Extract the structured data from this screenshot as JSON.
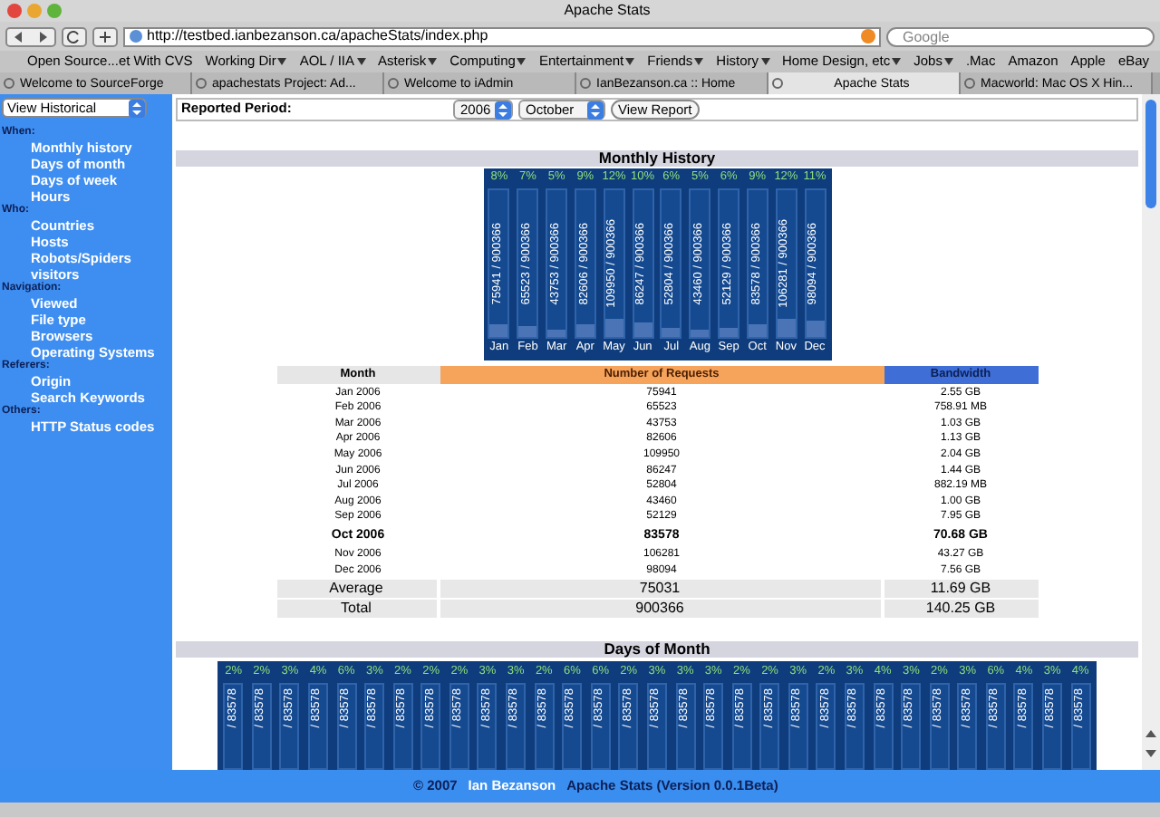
{
  "window": {
    "title": "Apache Stats"
  },
  "toolbar": {
    "url": "http://testbed.ianbezanson.ca/apacheStats/index.php",
    "search_placeholder": "Google"
  },
  "bookmarks": [
    {
      "label": "Open Source...et With CVS",
      "menu": false
    },
    {
      "label": "Working Dir",
      "menu": true
    },
    {
      "label": "AOL / IIA",
      "menu": true
    },
    {
      "label": "Asterisk",
      "menu": true
    },
    {
      "label": "Computing",
      "menu": true
    },
    {
      "label": "Entertainment",
      "menu": true
    },
    {
      "label": "Friends",
      "menu": true
    },
    {
      "label": "History",
      "menu": true
    },
    {
      "label": "Home Design, etc",
      "menu": true
    },
    {
      "label": "Jobs",
      "menu": true
    },
    {
      "label": ".Mac",
      "menu": false
    },
    {
      "label": "Amazon",
      "menu": false
    },
    {
      "label": "Apple",
      "menu": false
    },
    {
      "label": "eBay",
      "menu": false
    }
  ],
  "tabs": [
    {
      "label": "Welcome to SourceForge",
      "selected": false
    },
    {
      "label": "apachestats Project: Ad...",
      "selected": false
    },
    {
      "label": "Welcome to iAdmin",
      "selected": false
    },
    {
      "label": "IanBezanson.ca :: Home",
      "selected": false
    },
    {
      "label": "Apache Stats",
      "selected": true
    },
    {
      "label": "Macworld: Mac OS X Hin...",
      "selected": false
    }
  ],
  "sidebar": {
    "view_select": "View Historical",
    "groups": [
      {
        "heading": "When:",
        "items": [
          "Monthly history",
          "Days of month",
          "Days of week",
          "Hours"
        ]
      },
      {
        "heading": "Who:",
        "items": [
          "Countries",
          "Hosts",
          "Robots/Spiders",
          "visitors"
        ]
      },
      {
        "heading": "Navigation:",
        "items": [
          "Viewed",
          "File type",
          "Browsers",
          "Operating Systems"
        ]
      },
      {
        "heading": "Referers:",
        "items": [
          "Origin",
          "Search Keywords"
        ]
      },
      {
        "heading": "Others:",
        "items": [
          "HTTP Status codes"
        ]
      }
    ]
  },
  "report_period": {
    "label": "Reported Period:",
    "year": "2006",
    "month": "October",
    "button": "View Report"
  },
  "monthly_history": {
    "title": "Monthly History",
    "bars": [
      {
        "percent": "8%",
        "count": "75941 / 900366",
        "month": "Jan",
        "level": 0.08
      },
      {
        "percent": "7%",
        "count": "65523 / 900366",
        "month": "Feb",
        "level": 0.07
      },
      {
        "percent": "5%",
        "count": "43753 / 900366",
        "month": "Mar",
        "level": 0.05
      },
      {
        "percent": "9%",
        "count": "82606 / 900366",
        "month": "Apr",
        "level": 0.09
      },
      {
        "percent": "12%",
        "count": "109950 / 900366",
        "month": "May",
        "level": 0.12
      },
      {
        "percent": "10%",
        "count": "86247 / 900366",
        "month": "Jun",
        "level": 0.1
      },
      {
        "percent": "6%",
        "count": "52804 / 900366",
        "month": "Jul",
        "level": 0.06
      },
      {
        "percent": "5%",
        "count": "43460 / 900366",
        "month": "Aug",
        "level": 0.05
      },
      {
        "percent": "6%",
        "count": "52129 / 900366",
        "month": "Sep",
        "level": 0.06
      },
      {
        "percent": "9%",
        "count": "83578 / 900366",
        "month": "Oct",
        "level": 0.09
      },
      {
        "percent": "12%",
        "count": "106281 / 900366",
        "month": "Nov",
        "level": 0.12
      },
      {
        "percent": "11%",
        "count": "98094 / 900366",
        "month": "Dec",
        "level": 0.11
      }
    ]
  },
  "table": {
    "columns": [
      "Month",
      "Number of Requests",
      "Bandwidth"
    ],
    "rows": [
      {
        "cells": [
          "Jan 2006",
          "75941",
          "2.55 GB"
        ],
        "selected": false
      },
      {
        "cells": [
          "Feb 2006",
          "65523",
          "758.91 MB"
        ],
        "selected": false
      },
      {
        "cells": [
          "Mar 2006",
          "43753",
          "1.03 GB"
        ],
        "selected": false
      },
      {
        "cells": [
          "Apr 2006",
          "82606",
          "1.13 GB"
        ],
        "selected": false
      },
      {
        "cells": [
          "May 2006",
          "109950",
          "2.04 GB"
        ],
        "selected": false
      },
      {
        "cells": [
          "Jun 2006",
          "86247",
          "1.44 GB"
        ],
        "selected": false
      },
      {
        "cells": [
          "Jul 2006",
          "52804",
          "882.19 MB"
        ],
        "selected": false
      },
      {
        "cells": [
          "Aug 2006",
          "43460",
          "1.00 GB"
        ],
        "selected": false
      },
      {
        "cells": [
          "Sep 2006",
          "52129",
          "7.95 GB"
        ],
        "selected": false
      },
      {
        "cells": [
          "Oct 2006",
          "83578",
          "70.68 GB"
        ],
        "selected": true
      },
      {
        "cells": [
          "Nov 2006",
          "106281",
          "43.27 GB"
        ],
        "selected": false
      },
      {
        "cells": [
          "Dec 2006",
          "98094",
          "7.56 GB"
        ],
        "selected": false
      }
    ],
    "summary": [
      [
        "Average",
        "75031",
        "11.69 GB"
      ],
      [
        "Total",
        "900366",
        "140.25 GB"
      ]
    ]
  },
  "days_of_month": {
    "title": "Days of Month",
    "bars": [
      {
        "percent": "2%",
        "count": "/ 83578"
      },
      {
        "percent": "2%",
        "count": "/ 83578"
      },
      {
        "percent": "3%",
        "count": "/ 83578"
      },
      {
        "percent": "4%",
        "count": "/ 83578"
      },
      {
        "percent": "6%",
        "count": "/ 83578"
      },
      {
        "percent": "3%",
        "count": "/ 83578"
      },
      {
        "percent": "2%",
        "count": "/ 83578"
      },
      {
        "percent": "2%",
        "count": "/ 83578"
      },
      {
        "percent": "2%",
        "count": "/ 83578"
      },
      {
        "percent": "3%",
        "count": "/ 83578"
      },
      {
        "percent": "3%",
        "count": "/ 83578"
      },
      {
        "percent": "2%",
        "count": "/ 83578"
      },
      {
        "percent": "6%",
        "count": "/ 83578"
      },
      {
        "percent": "6%",
        "count": "/ 83578"
      },
      {
        "percent": "2%",
        "count": "/ 83578"
      },
      {
        "percent": "3%",
        "count": "/ 83578"
      },
      {
        "percent": "3%",
        "count": "/ 83578"
      },
      {
        "percent": "3%",
        "count": "/ 83578"
      },
      {
        "percent": "2%",
        "count": "/ 83578"
      },
      {
        "percent": "2%",
        "count": "/ 83578"
      },
      {
        "percent": "3%",
        "count": "/ 83578"
      },
      {
        "percent": "2%",
        "count": "/ 83578"
      },
      {
        "percent": "3%",
        "count": "/ 83578"
      },
      {
        "percent": "4%",
        "count": "/ 83578"
      },
      {
        "percent": "3%",
        "count": "/ 83578"
      },
      {
        "percent": "2%",
        "count": "/ 83578"
      },
      {
        "percent": "3%",
        "count": "/ 83578"
      },
      {
        "percent": "6%",
        "count": "/ 83578"
      },
      {
        "percent": "4%",
        "count": "/ 83578"
      },
      {
        "percent": "3%",
        "count": "/ 83578"
      },
      {
        "percent": "4%",
        "count": "/ 83578"
      }
    ]
  },
  "footer": {
    "prefix": "© 2007",
    "author": "Ian Bezanson",
    "app": "Apache Stats (Version 0.0.1Beta)"
  }
}
